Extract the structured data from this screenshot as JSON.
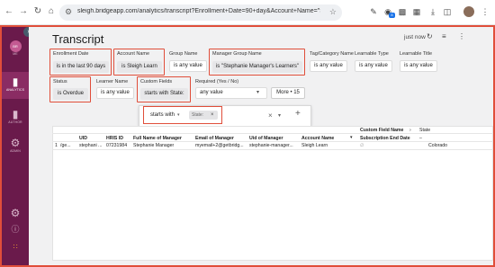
{
  "browser": {
    "url": "sleigh.bridgeapp.com/analytics/transcript?Enrollment+Date=90+day&Account+Name=\"Sleigh+Learn\"&Group+...",
    "extension_badge": "8"
  },
  "sidebar": {
    "items": [
      {
        "icon": "user-circle-icon",
        "label": "ME"
      },
      {
        "icon": "bar-chart-icon",
        "label": "ANALYTICS"
      },
      {
        "icon": "book-icon",
        "label": "AUTHOR"
      },
      {
        "icon": "gears-icon",
        "label": "ADMIN"
      }
    ],
    "bottom_icons": [
      "settings-icon",
      "help-icon",
      "apps-grid-icon"
    ]
  },
  "page": {
    "title": "Transcript",
    "refreshed": "just now"
  },
  "filters_row1": [
    {
      "label": "Enrollment Date",
      "value": "is in the last 90 days",
      "highlight": true
    },
    {
      "label": "Account Name",
      "value": "is Sleigh Learn",
      "highlight": true
    },
    {
      "label": "Group Name",
      "value": "is any value",
      "highlight": false
    },
    {
      "label": "Manager Group Name",
      "value": "is \"Stephanie Manager's Learners\"",
      "highlight": true
    },
    {
      "label": "Tag/Category Name",
      "value": "is any value",
      "highlight": false
    },
    {
      "label": "Learnable Type",
      "value": "is any value",
      "highlight": false
    },
    {
      "label": "Learnable Title",
      "value": "is any value",
      "highlight": false
    }
  ],
  "filters_row2": [
    {
      "label": "Status",
      "value": "is Overdue",
      "highlight": true
    },
    {
      "label": "Learner Name",
      "value": "is any value",
      "highlight": false
    },
    {
      "label": "Custom Fields",
      "value": "starts with State:",
      "highlight": true
    },
    {
      "label": "Required (Yes / No)",
      "value": "any value",
      "highlight": false
    }
  ],
  "more_button": "More • 15",
  "popover": {
    "operator": "starts with",
    "chip": "State:"
  },
  "table": {
    "headers": [
      "UID",
      "HRIS ID",
      "Full Name of Manager",
      "Email of Manager",
      "Uid of Manager",
      "Account Name"
    ],
    "custom_field_header": "Custom Field Name",
    "custom_field_sub": "Subscription End Date",
    "state_header": "State",
    "rows": [
      {
        "num": "1",
        "name": "/ge...",
        "uid": "stephani ...",
        "hris": "07231984",
        "manager": "Stephanie Manager",
        "email": "myemail+2@getbridg...",
        "uid_mgr": "stephanie-manager...",
        "account": "Sleigh Learn",
        "sub": "∅",
        "state": "Colorado"
      }
    ]
  }
}
